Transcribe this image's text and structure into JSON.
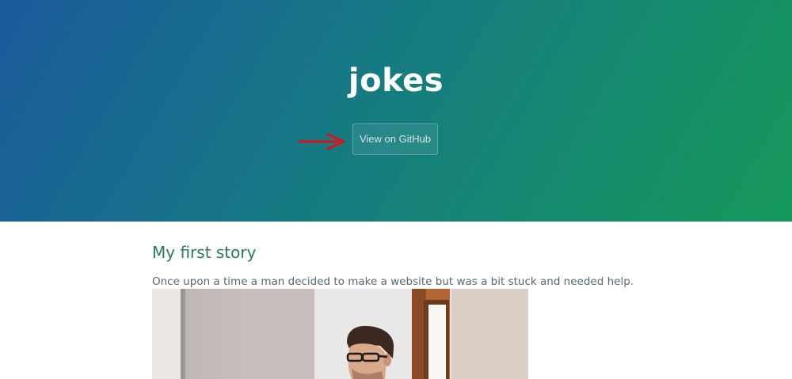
{
  "header": {
    "project_name": "jokes",
    "github_button_label": "View on GitHub"
  },
  "story": {
    "title": "My first story",
    "text": "Once upon a time a man decided to make a website but was a bit stuck and needed help."
  },
  "colors": {
    "header_gradient_start": "#1a5a9c",
    "header_gradient_end": "#15995a",
    "heading_green": "#2a7a55",
    "body_text": "#5a6670",
    "annotation_arrow": "#e0101a"
  },
  "icons": {
    "annotation": "red-arrow-icon"
  }
}
